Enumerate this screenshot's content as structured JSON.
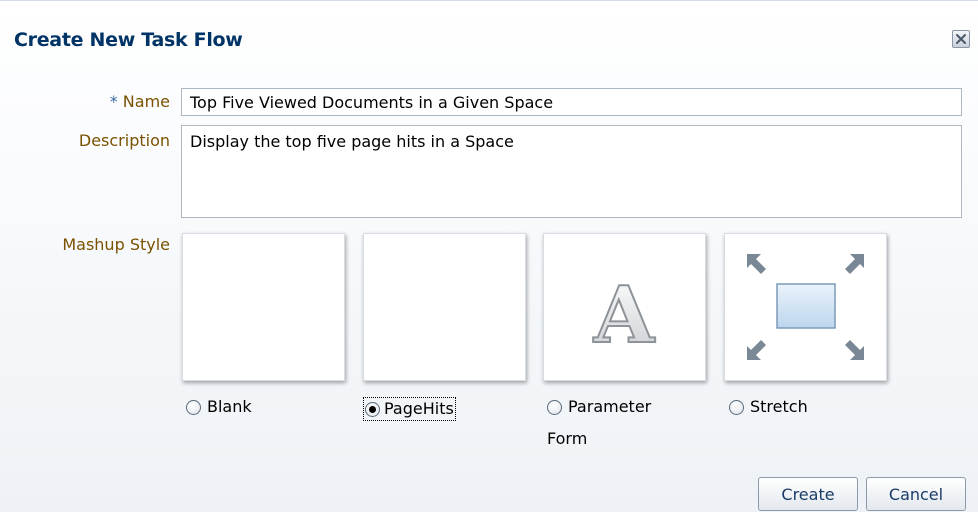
{
  "dialog": {
    "title": "Create New Task Flow"
  },
  "form": {
    "name": {
      "required_marker": "*",
      "label": "Name",
      "value": "Top Five Viewed Documents in a Given Space"
    },
    "description": {
      "label": "Description",
      "value": "Display the top five page hits in a Space"
    },
    "mashup_style": {
      "label": "Mashup Style",
      "selected": "PageHits",
      "options": [
        {
          "label": "Blank",
          "checked": false,
          "thumbnail": "blank"
        },
        {
          "label": "PageHits",
          "checked": true,
          "thumbnail": "blank"
        },
        {
          "label_line1": "Parameter",
          "label_line2": "Form",
          "checked": false,
          "thumbnail": "letter-a-icon"
        },
        {
          "label": "Stretch",
          "checked": false,
          "thumbnail": "stretch-arrows-icon"
        }
      ],
      "thumbnail_glyph": "A"
    }
  },
  "actions": {
    "create_label": "Create",
    "cancel_label": "Cancel"
  },
  "colors": {
    "title": "#003366",
    "label": "#7a5200",
    "button_text": "#1a3b66"
  }
}
